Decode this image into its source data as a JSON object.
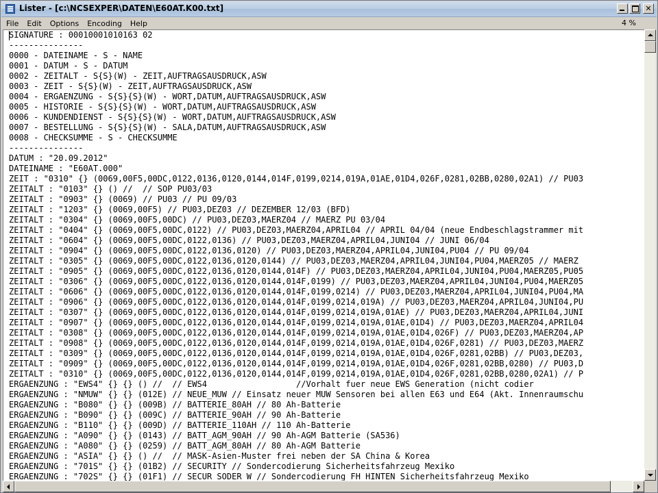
{
  "window": {
    "title": "Lister - [c:\\NCSEXPER\\DATEN\\E60AT.K00.txt]"
  },
  "menubar": {
    "items": [
      "File",
      "Edit",
      "Options",
      "Encoding",
      "Help"
    ],
    "percent": "4 %"
  },
  "icons": {
    "app": "lister-app-icon",
    "minimize": "minimize-icon",
    "maximize": "maximize-icon",
    "close": "close-icon"
  },
  "editor": {
    "scroll_position_vertical": 0.04,
    "lines": [
      "SIGNATURE : 00010001010163 02",
      "---------------",
      "0000 - DATEINAME - S - NAME",
      "0001 - DATUM - S - DATUM",
      "0002 - ZEITALT - S{S}(W) - ZEIT,AUFTRAGSAUSDRUCK,ASW",
      "0003 - ZEIT - S{S}(W) - ZEIT,AUFTRAGSAUSDRUCK,ASW",
      "0004 - ERGAENZUNG - S{S}{S}(W) - WORT,DATUM,AUFTRAGSAUSDRUCK,ASW",
      "0005 - HISTORIE - S{S}{S}(W) - WORT,DATUM,AUFTRAGSAUSDRUCK,ASW",
      "0006 - KUNDENDIENST - S{S}{S}(W) - WORT,DATUM,AUFTRAGSAUSDRUCK,ASW",
      "0007 - BESTELLUNG - S{S}{S}(W) - SALA,DATUM,AUFTRAGSAUSDRUCK,ASW",
      "0008 - CHECKSUMME - S - CHECKSUMME",
      "---------------",
      "DATUM : \"20.09.2012\"",
      "DATEINAME : \"E60AT.000\"",
      "ZEIT : \"0310\" {} (0069,00F5,00DC,0122,0136,0120,0144,014F,0199,0214,019A,01AE,01D4,026F,0281,02BB,0280,02A1) // PU03",
      "ZEITALT : \"0103\" {} () //  // SOP PU03/03",
      "ZEITALT : \"0903\" {} (0069) // PU03 // PU 09/03",
      "ZEITALT : \"1203\" {} (0069,00F5) // PU03,DEZ03 // DEZEMBER 12/03 (BFD)",
      "ZEITALT : \"0304\" {} (0069,00F5,00DC) // PU03,DEZ03,MAERZ04 // MAERZ PU 03/04",
      "ZEITALT : \"0404\" {} (0069,00F5,00DC,0122) // PU03,DEZ03,MAERZ04,APRIL04 // APRIL 04/04 (neue Endbeschlagstrammer mit",
      "ZEITALT : \"0604\" {} (0069,00F5,00DC,0122,0136) // PU03,DEZ03,MAERZ04,APRIL04,JUNI04 // JUNI 06/04",
      "ZEITALT : \"0904\" {} (0069,00F5,00DC,0122,0136,0120) // PU03,DEZ03,MAERZ04,APRIL04,JUNI04,PU04 // PU 09/04",
      "ZEITALT : \"0305\" {} (0069,00F5,00DC,0122,0136,0120,0144) // PU03,DEZ03,MAERZ04,APRIL04,JUNI04,PU04,MAERZ05 // MAERZ",
      "ZEITALT : \"0905\" {} (0069,00F5,00DC,0122,0136,0120,0144,014F) // PU03,DEZ03,MAERZ04,APRIL04,JUNI04,PU04,MAERZ05,PU05",
      "ZEITALT : \"0306\" {} (0069,00F5,00DC,0122,0136,0120,0144,014F,0199) // PU03,DEZ03,MAERZ04,APRIL04,JUNI04,PU04,MAERZ05",
      "ZEITALT : \"0606\" {} (0069,00F5,00DC,0122,0136,0120,0144,014F,0199,0214) // PU03,DEZ03,MAERZ04,APRIL04,JUNI04,PU04,MA",
      "ZEITALT : \"0906\" {} (0069,00F5,00DC,0122,0136,0120,0144,014F,0199,0214,019A) // PU03,DEZ03,MAERZ04,APRIL04,JUNI04,PU",
      "ZEITALT : \"0307\" {} (0069,00F5,00DC,0122,0136,0120,0144,014F,0199,0214,019A,01AE) // PU03,DEZ03,MAERZ04,APRIL04,JUNI",
      "ZEITALT : \"0907\" {} (0069,00F5,00DC,0122,0136,0120,0144,014F,0199,0214,019A,01AE,01D4) // PU03,DEZ03,MAERZ04,APRIL04",
      "ZEITALT : \"0308\" {} (0069,00F5,00DC,0122,0136,0120,0144,014F,0199,0214,019A,01AE,01D4,026F) // PU03,DEZ03,MAERZ04,AP",
      "ZEITALT : \"0908\" {} (0069,00F5,00DC,0122,0136,0120,0144,014F,0199,0214,019A,01AE,01D4,026F,0281) // PU03,DEZ03,MAERZ",
      "ZEITALT : \"0309\" {} (0069,00F5,00DC,0122,0136,0120,0144,014F,0199,0214,019A,01AE,01D4,026F,0281,02BB) // PU03,DEZ03,",
      "ZEITALT : \"0909\" {} (0069,00F5,00DC,0122,0136,0120,0144,014F,0199,0214,019A,01AE,01D4,026F,0281,02BB,0280) // PU03,D",
      "ZEITALT : \"0310\" {} (0069,00F5,00DC,0122,0136,0120,0144,014F,0199,0214,019A,01AE,01D4,026F,0281,02BB,0280,02A1) // P",
      "ERGAENZUNG : \"EWS4\" {} {} () //  // EWS4                  //Vorhalt fuer neue EWS Generation (nicht codier",
      "ERGAENZUNG : \"NMUW\" {} {} (012E) // NEUE_MUW // Einsatz neuer MUW Sensoren bei allen E63 und E64 (Akt. Innenraumschu",
      "ERGAENZUNG : \"B080\" {} {} (009B) // BATTERIE_80AH // 80 Ah-Batterie",
      "ERGAENZUNG : \"B090\" {} {} (009C) // BATTERIE_90AH // 90 Ah-Batterie",
      "ERGAENZUNG : \"B110\" {} {} (009D) // BATTERIE_110AH // 110 Ah-Batterie",
      "ERGAENZUNG : \"A090\" {} {} (0143) // BATT_AGM_90AH // 90 Ah-AGM Batterie (SA536)",
      "ERGAENZUNG : \"A080\" {} {} (0259) // BATT_AGM_80AH // 80 Ah-AGM Batterie",
      "ERGAENZUNG : \"ASIA\" {} {} () //  // MASK-Asien-Muster frei neben der SA China & Korea",
      "ERGAENZUNG : \"701S\" {} {} (01B2) // SECURITY // Sondercodierung Sicherheitsfahrzeug Mexiko",
      "ERGAENZUNG : \"702S\" {} {} (01F1) // SECUR SODER W // Sondercodierung FH HINTEN Sicherheitsfahrzeug Mexiko"
    ]
  }
}
